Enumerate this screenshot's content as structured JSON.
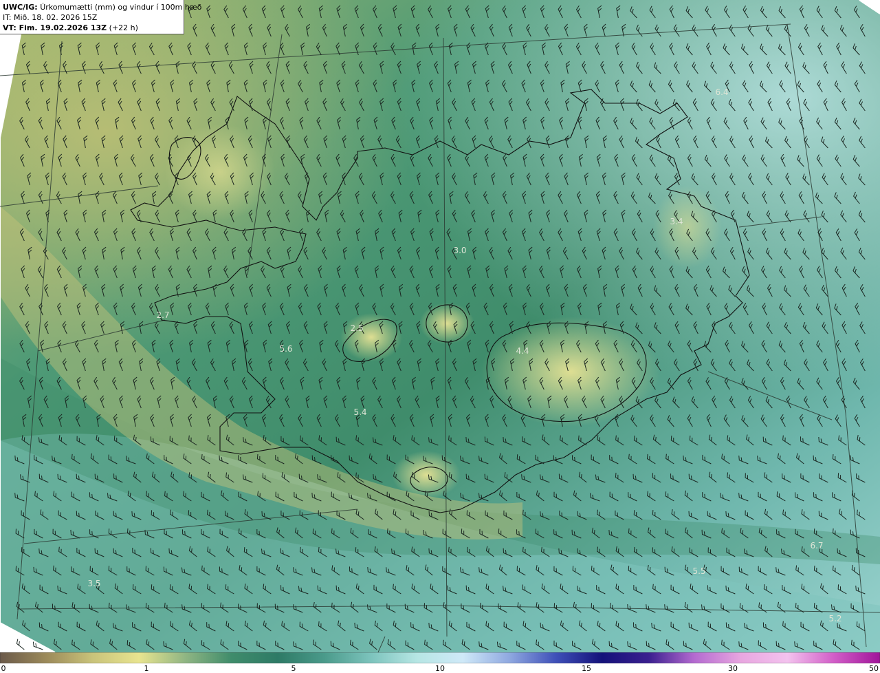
{
  "header": {
    "model": "UWC/IG:",
    "title": "Úrkomumætti (mm) og vindur í 100m hæð",
    "it_label": "IT: Mið. 18. 02. 2026 15Z",
    "vt_label": "VT: Fim. 19.02.2026 13Z",
    "vt_offset": "(+22 h)"
  },
  "map_labels": [
    "6.4",
    "3.4",
    "3.0",
    "2.7",
    "2.5",
    "5.6",
    "4.4",
    "5.4",
    "3.5",
    "6.7",
    "5.5",
    "5.2"
  ],
  "colorbar": {
    "ticks": [
      "0",
      "1",
      "5",
      "10",
      "15",
      "30",
      "50"
    ],
    "colors": [
      "#6b5a4a",
      "#9c8a5a",
      "#c9c37a",
      "#e8e48f",
      "#8fb583",
      "#3f8c6b",
      "#2e7a66",
      "#4a9a8a",
      "#7cc3bc",
      "#b6e6e4",
      "#cfe9f8",
      "#8fa8e0",
      "#3e4fb8",
      "#14127a",
      "#3a1f8f",
      "#b46ad0",
      "#e8a6e0",
      "#f3c2ee",
      "#d25ec8",
      "#a0149a"
    ],
    "accent": "#3f8c6b"
  }
}
